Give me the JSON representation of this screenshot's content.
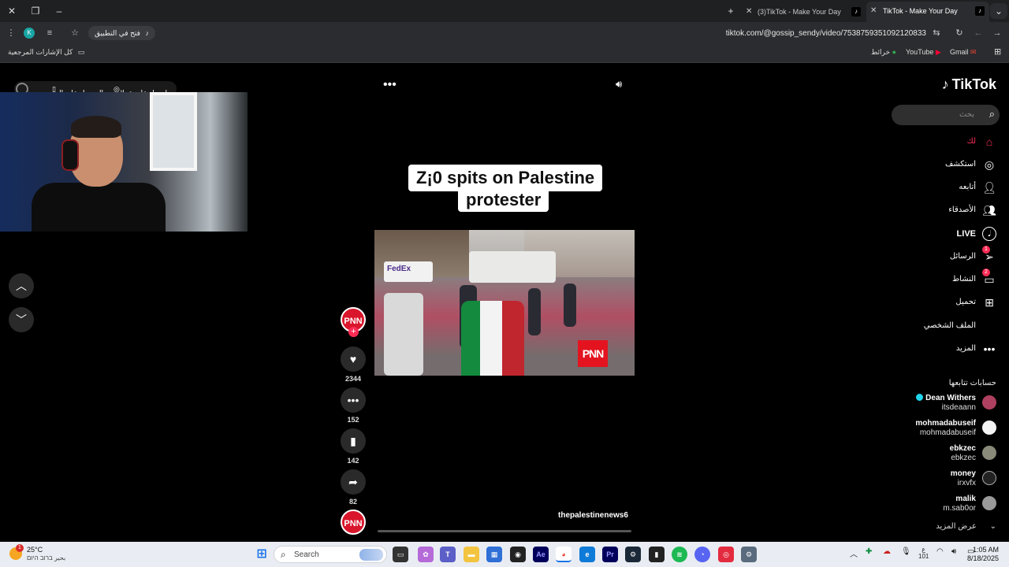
{
  "browser": {
    "tabs": [
      {
        "title": "(3)TikTok - Make Your Day",
        "active": false
      },
      {
        "title": "TikTok - Make Your Day",
        "active": true
      }
    ],
    "url": "tiktok.com/@gossip_sendy/video/7538759351092120833",
    "open_in_app_chip": "فتح في التطبيق",
    "profile_initial": "K",
    "bookmarks": {
      "all_bookmarks": "كل الإشارات المرجعية",
      "gmail": "Gmail",
      "youtube": "YouTube",
      "maps": "خرائط"
    }
  },
  "page": {
    "top_left": {
      "get_coins": "احصل على عملات",
      "get_app": "الحصول على الت..."
    },
    "caption_line1": "Z¡0 spits on Palestine",
    "caption_line2": "protester",
    "video_watermark": "PNN",
    "video_truck_text": "FedEx",
    "author": "thepalestinenews6",
    "actions": {
      "avatar_text": "PNN",
      "likes": "2344",
      "comments": "152",
      "saves": "142",
      "shares": "82"
    }
  },
  "sidebar": {
    "logo": "TikTok",
    "search_placeholder": "بحث",
    "nav": [
      {
        "label": "لك",
        "icon": "home-icon"
      },
      {
        "label": "استكشف",
        "icon": "compass-icon"
      },
      {
        "label": "أتابعه",
        "icon": "following-icon"
      },
      {
        "label": "الأصدقاء",
        "icon": "friends-icon"
      },
      {
        "label": "LIVE",
        "icon": "live-icon"
      },
      {
        "label": "الرسائل",
        "icon": "messages-icon",
        "badge": "1"
      },
      {
        "label": "النشاط",
        "icon": "activity-icon",
        "badge": "2"
      },
      {
        "label": "تحميل",
        "icon": "upload-icon"
      },
      {
        "label": "الملف الشخصي",
        "icon": "profile-icon"
      },
      {
        "label": "المزيد",
        "icon": "more-icon"
      }
    ],
    "following_title": "حسابات تتابعها",
    "following": [
      {
        "name": "Dean Withers",
        "username": "itsdeaann",
        "verified": true
      },
      {
        "name": "mohmadabuseif",
        "username": "mohmadabuseif",
        "verified": false
      },
      {
        "name": "ebkzec",
        "username": "ebkzec",
        "verified": false
      },
      {
        "name": "money",
        "username": "irxvfx",
        "verified": false
      },
      {
        "name": "malik",
        "username": "m.sab0or",
        "verified": false
      }
    ],
    "see_more": "عرض المزيد"
  },
  "taskbar": {
    "weather_temp": "25°C",
    "weather_desc": "بحير ברוב היום",
    "weather_badge": "1",
    "search_label": "Search",
    "tray_lang": "ع",
    "tray_lang_sub": "101",
    "time": "1:05 AM",
    "date": "8/18/2025"
  },
  "colors": {
    "accent": "#fe2c55",
    "background": "#000000",
    "chrome": "#2b2c2f"
  }
}
